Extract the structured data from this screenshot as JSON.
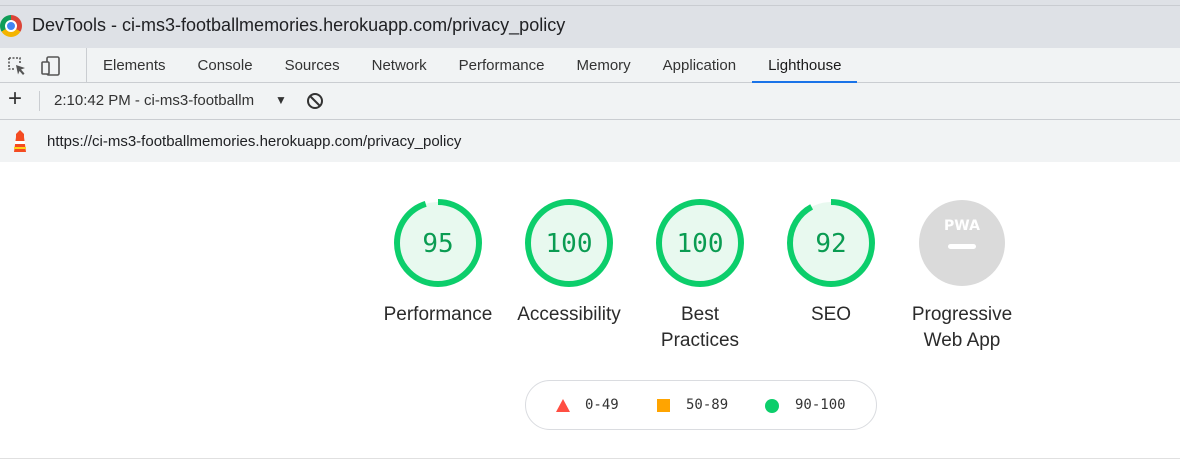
{
  "window": {
    "title": "DevTools - ci-ms3-footballmemories.herokuapp.com/privacy_policy"
  },
  "toolbar": {
    "inspect_icon": "inspect-element-icon",
    "device_icon": "device-toolbar-icon",
    "tabs": [
      {
        "label": "Elements"
      },
      {
        "label": "Console"
      },
      {
        "label": "Sources"
      },
      {
        "label": "Network"
      },
      {
        "label": "Performance"
      },
      {
        "label": "Memory"
      },
      {
        "label": "Application"
      },
      {
        "label": "Lighthouse",
        "active": true
      }
    ]
  },
  "report_bar": {
    "add_label": "+",
    "report_selected": "2:10:42 PM - ci-ms3-footballm",
    "dropdown_arrow": "▼"
  },
  "url_bar": {
    "url": "https://ci-ms3-footballmemories.herokuapp.com/privacy_policy"
  },
  "scores": [
    {
      "label": "Performance",
      "score": "95"
    },
    {
      "label": "Accessibility",
      "score": "100"
    },
    {
      "label": "Best Practices",
      "line1": "Best",
      "line2": "Practices",
      "score": "100"
    },
    {
      "label": "SEO",
      "score": "92"
    },
    {
      "label": "Progressive Web App",
      "line1": "Progressive",
      "line2": "Web App",
      "badge": "PWA"
    }
  ],
  "legend": {
    "fail": "0-49",
    "average": "50-89",
    "pass": "90-100"
  },
  "colors": {
    "pass": "#0cce6b",
    "pass_fill": "#e8f9ef",
    "average": "#ffa400",
    "fail": "#ff4e42",
    "pass_text": "#0a9c52",
    "pwa_gray": "#dadada",
    "accent": "#1a73e8"
  }
}
